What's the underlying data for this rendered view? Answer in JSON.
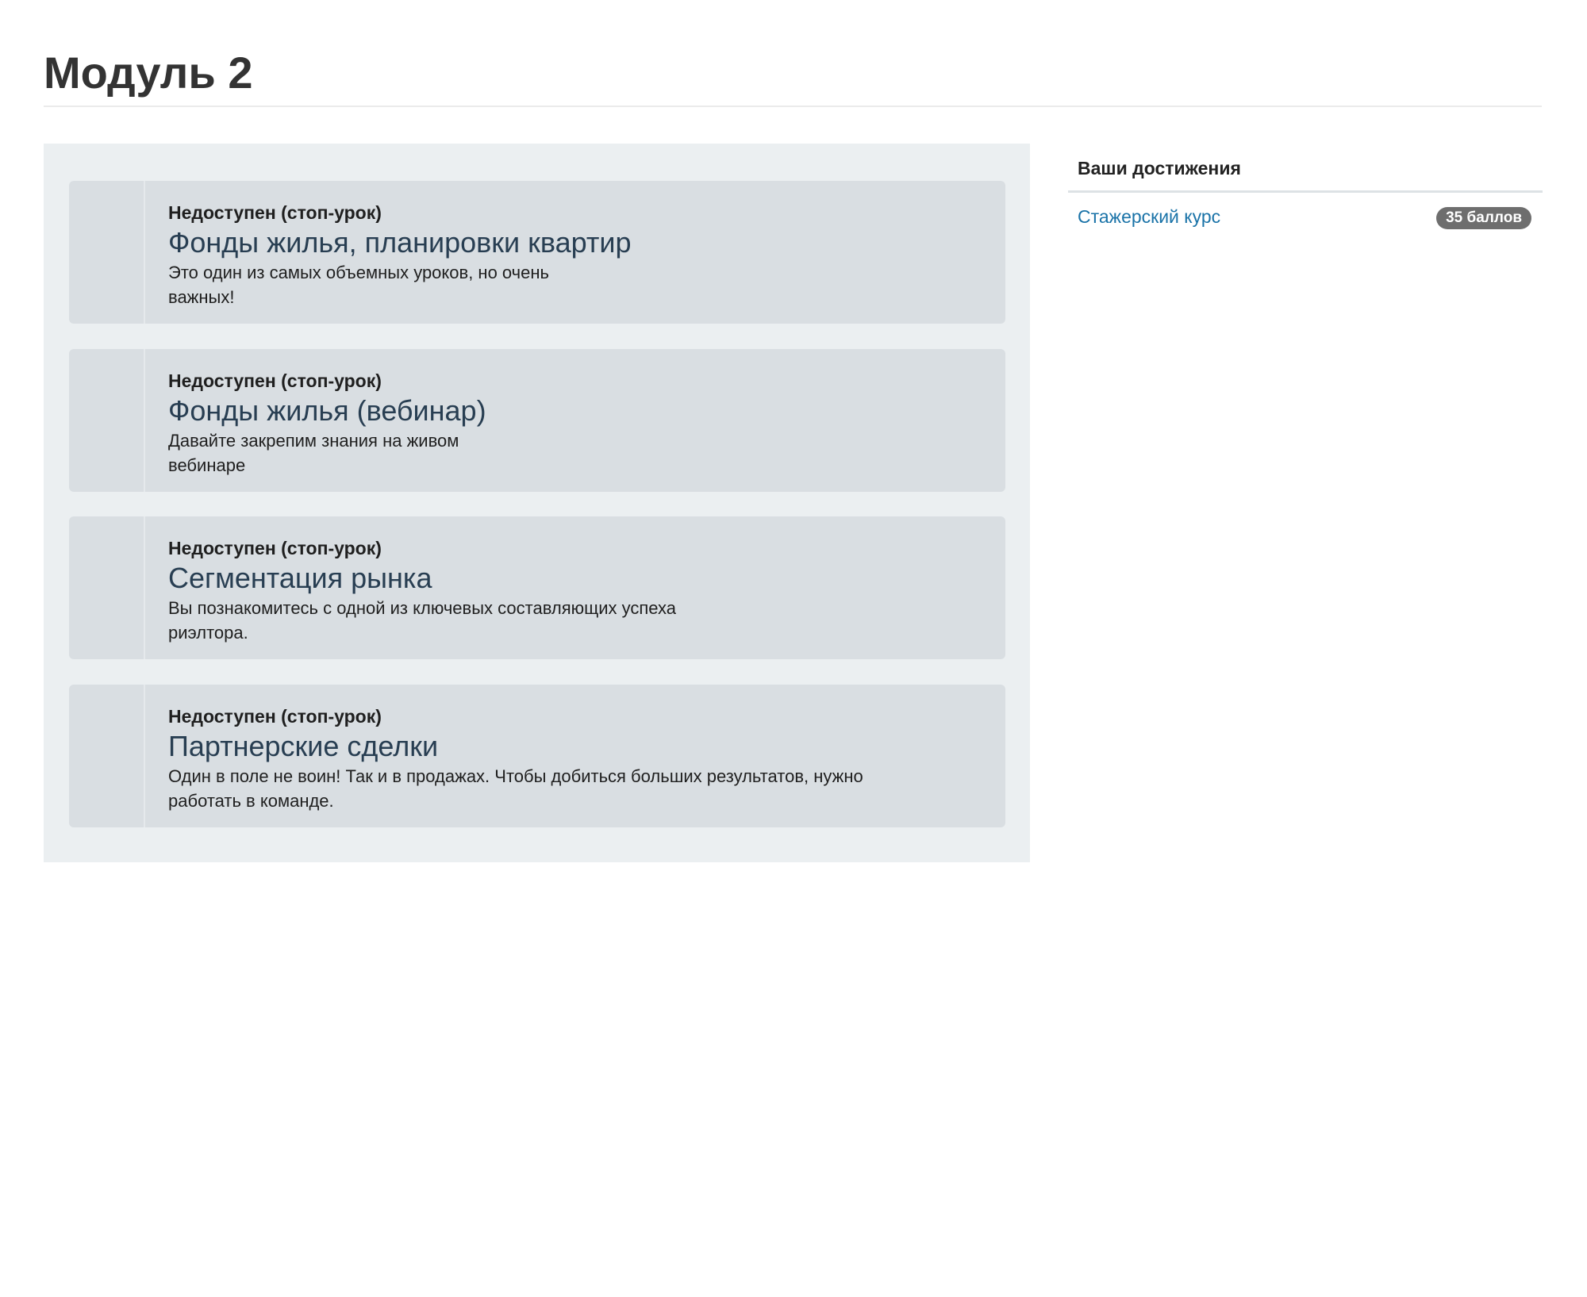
{
  "page": {
    "title": "Модуль 2"
  },
  "lessons": [
    {
      "status": "Недоступен (стоп-урок)",
      "title": "Фонды жилья, планировки квартир",
      "description_line1": "Это один из самых объемных уроков, но очень",
      "description_line2": "важных!"
    },
    {
      "status": "Недоступен (стоп-урок)",
      "title": "Фонды жилья (вебинар)",
      "description_line1": "Давайте закрепим знания на живом",
      "description_line2": "вебинаре"
    },
    {
      "status": "Недоступен (стоп-урок)",
      "title": "Сегментация рынка",
      "description_line1": "Вы познакомитесь с одной из ключевых составляющих успеха",
      "description_line2": "риэлтора."
    },
    {
      "status": "Недоступен (стоп-урок)",
      "title": "Партнерские сделки",
      "description_line1": "Один в поле не воин! Так и в продажах. Чтобы добиться больших результатов, нужно",
      "description_line2": "работать в команде."
    }
  ],
  "sidebar": {
    "title": "Ваши достижения",
    "achievements": [
      {
        "label": "Стажерский курс",
        "points": "35 баллов"
      }
    ]
  },
  "colors": {
    "panel_bg": "#ebeff1",
    "card_bg": "#d9dee2",
    "lesson_title": "#283e52",
    "link": "#1a73a8",
    "badge_bg": "#6e6e6e"
  }
}
